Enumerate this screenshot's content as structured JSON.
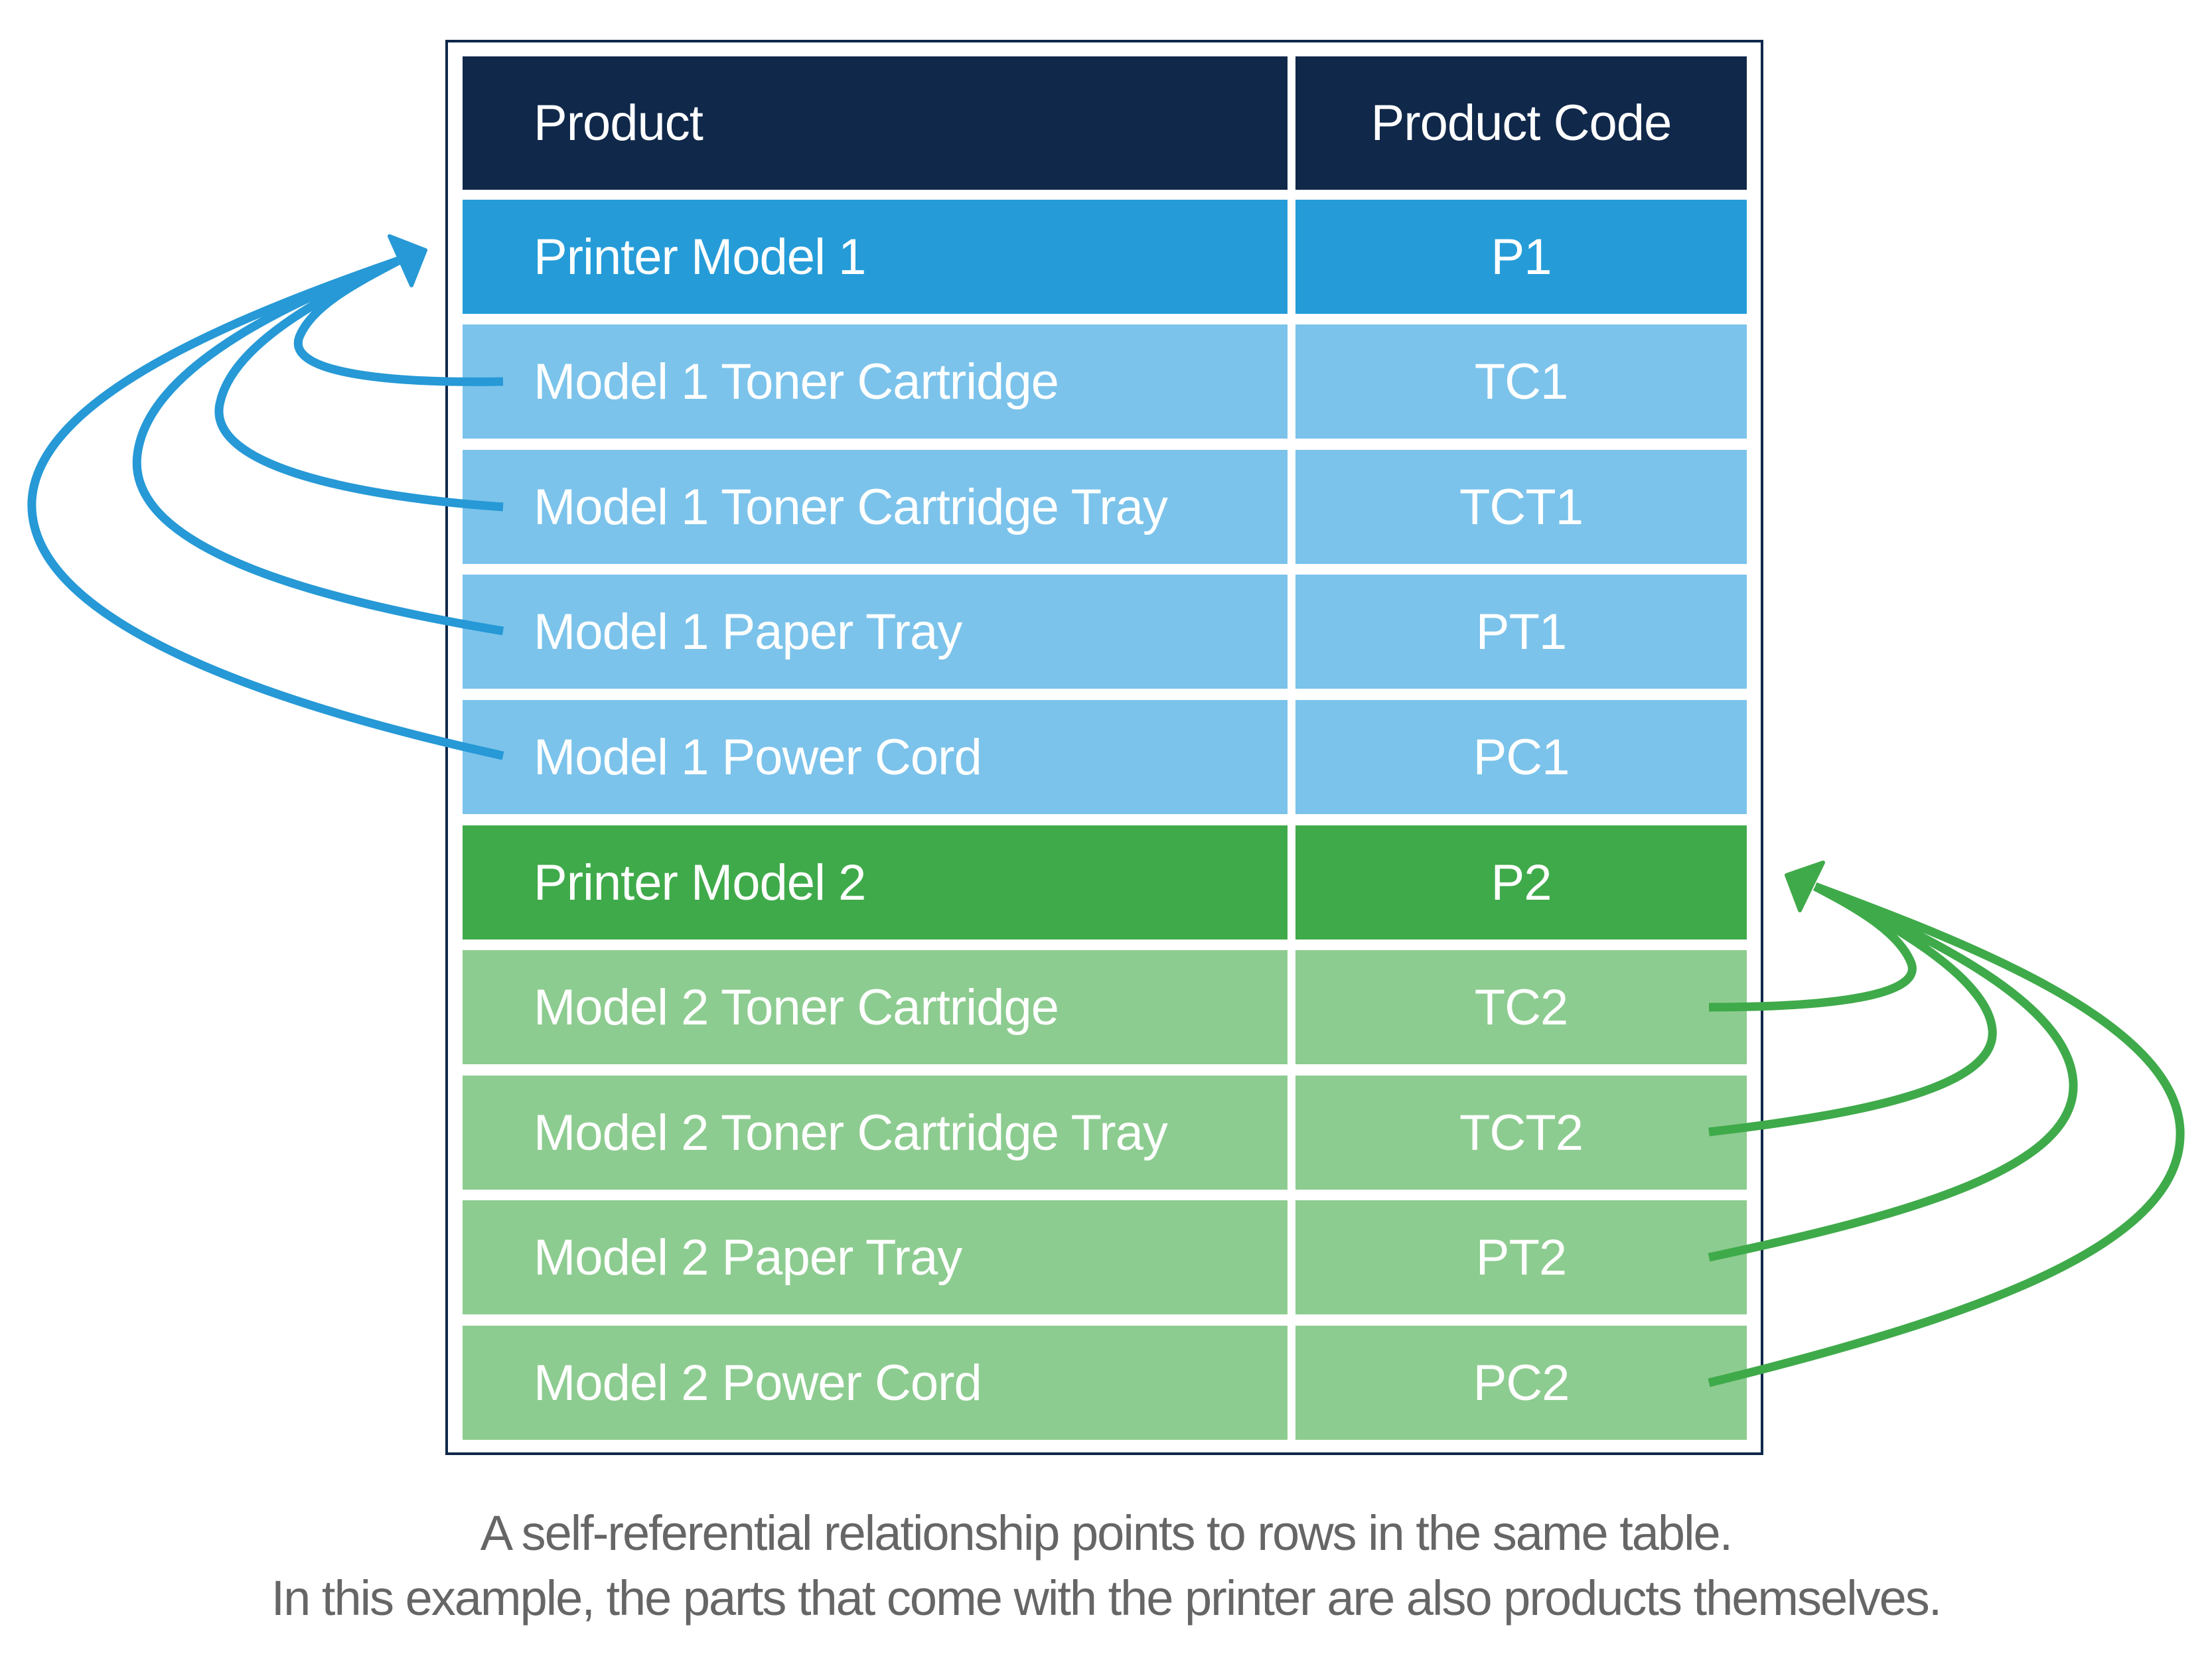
{
  "table": {
    "headers": {
      "product": "Product",
      "code": "Product Code"
    },
    "rows": [
      {
        "product": "Printer Model 1",
        "code": "P1",
        "group": "model-1",
        "role": "parent"
      },
      {
        "product": "Model 1 Toner Cartridge",
        "code": "TC1",
        "group": "model-1",
        "role": "child"
      },
      {
        "product": "Model 1 Toner Cartridge Tray",
        "code": "TCT1",
        "group": "model-1",
        "role": "child"
      },
      {
        "product": "Model 1 Paper Tray",
        "code": "PT1",
        "group": "model-1",
        "role": "child"
      },
      {
        "product": "Model 1 Power Cord",
        "code": "PC1",
        "group": "model-1",
        "role": "child"
      },
      {
        "product": "Printer Model 2",
        "code": "P2",
        "group": "model-2",
        "role": "parent"
      },
      {
        "product": "Model 2 Toner Cartridge",
        "code": "TC2",
        "group": "model-2",
        "role": "child"
      },
      {
        "product": "Model 2 Toner Cartridge Tray",
        "code": "TCT2",
        "group": "model-2",
        "role": "child"
      },
      {
        "product": "Model 2 Paper Tray",
        "code": "PT2",
        "group": "model-2",
        "role": "child"
      },
      {
        "product": "Model 2 Power Cord",
        "code": "PC2",
        "group": "model-2",
        "role": "child"
      }
    ]
  },
  "relationships": [
    {
      "from": "TC1",
      "to": "P1"
    },
    {
      "from": "TCT1",
      "to": "P1"
    },
    {
      "from": "PT1",
      "to": "P1"
    },
    {
      "from": "PC1",
      "to": "P1"
    },
    {
      "from": "TC2",
      "to": "P2"
    },
    {
      "from": "TCT2",
      "to": "P2"
    },
    {
      "from": "PT2",
      "to": "P2"
    },
    {
      "from": "PC2",
      "to": "P2"
    }
  ],
  "colors": {
    "header": "#10284a",
    "model_1_parent": "#259cd8",
    "model_1_child": "#7bc3eb",
    "model_1_arrow": "#2699d6",
    "model_2_parent": "#3faa4a",
    "model_2_child": "#8dcc90",
    "model_2_arrow": "#3faa4a",
    "caption": "#666666"
  },
  "caption": {
    "line1": "A self-referential relationship points to rows in the same table.",
    "line2": "In this example, the parts that come with the printer are also products themselves."
  }
}
